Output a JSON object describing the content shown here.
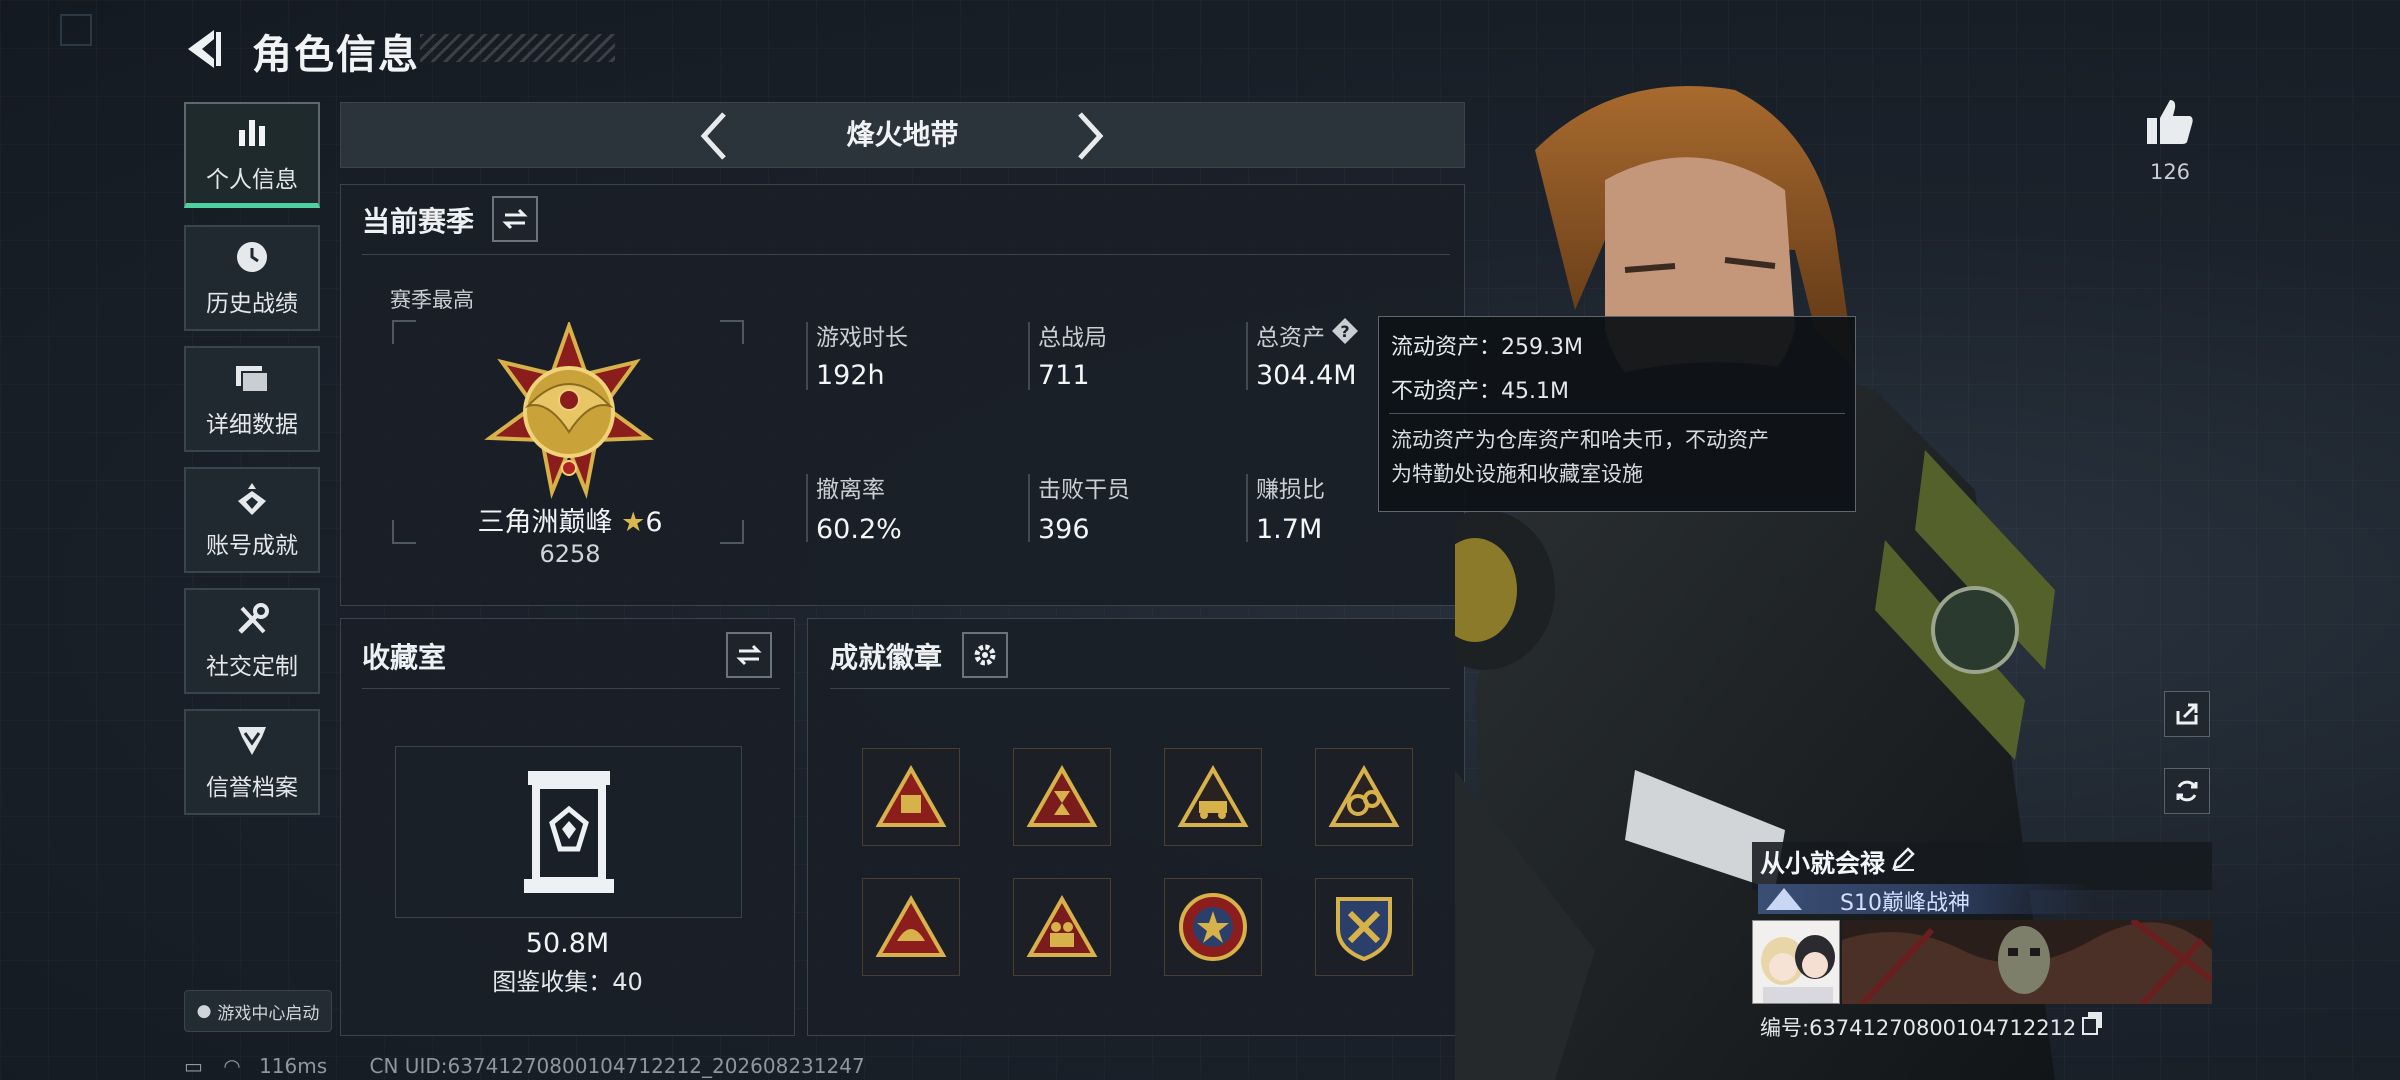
{
  "header": {
    "title": "角色信息"
  },
  "sidebar": {
    "items": [
      {
        "label": "个人信息",
        "icon": "bar-chart-icon",
        "active": true
      },
      {
        "label": "历史战绩",
        "icon": "clock-icon"
      },
      {
        "label": "详细数据",
        "icon": "folder-icon"
      },
      {
        "label": "账号成就",
        "icon": "achievement-icon"
      },
      {
        "label": "社交定制",
        "icon": "tools-icon"
      },
      {
        "label": "信誉档案",
        "icon": "shield-chevron-icon"
      }
    ],
    "game_center": "游戏中心启动"
  },
  "mode": {
    "title": "烽火地带"
  },
  "season": {
    "title": "当前赛季",
    "best_label": "赛季最高",
    "rank_name": "三角洲巅峰",
    "rank_stars": "6",
    "rank_points": "6258",
    "stats": [
      {
        "label": "游戏时长",
        "value": "192h"
      },
      {
        "label": "总战局",
        "value": "711"
      },
      {
        "label": "总资产",
        "value": "304.4M"
      },
      {
        "label": "撤离率",
        "value": "60.2%"
      },
      {
        "label": "击败干员",
        "value": "396"
      },
      {
        "label": "赚损比",
        "value": "1.7M"
      }
    ]
  },
  "tooltip": {
    "liquid": "流动资产：259.3M",
    "fixed": "不动资产：45.1M",
    "desc_line1": "流动资产为仓库资产和哈夫币，不动资产",
    "desc_line2": "为特勤处设施和收藏室设施"
  },
  "collection": {
    "title": "收藏室",
    "value": "50.8M",
    "count": "图鉴收集：40"
  },
  "badges": {
    "title": "成就徽章",
    "items": [
      {
        "icon": "badge-triangle-56-icon"
      },
      {
        "icon": "badge-triangle-hourglass-icon"
      },
      {
        "icon": "badge-triangle-vehicle-icon"
      },
      {
        "icon": "badge-triangle-gears-icon"
      },
      {
        "icon": "badge-triangle-helmet-icon"
      },
      {
        "icon": "badge-triangle-soldiers-icon"
      },
      {
        "icon": "badge-round-star-icon"
      },
      {
        "icon": "badge-shield-wrench-icon"
      }
    ]
  },
  "profile": {
    "likes": "126",
    "name": "从小就会禄",
    "title": "S10巅峰战神",
    "uid": "编号:6374127080010471221​2"
  },
  "status_bar": {
    "ping": "116ms",
    "uid": "CN UID:6374127080010471221​2_202608231247"
  },
  "colors": {
    "accent": "#4fd0a3",
    "gold": "#c9a23a",
    "panel": "#1a2027"
  }
}
